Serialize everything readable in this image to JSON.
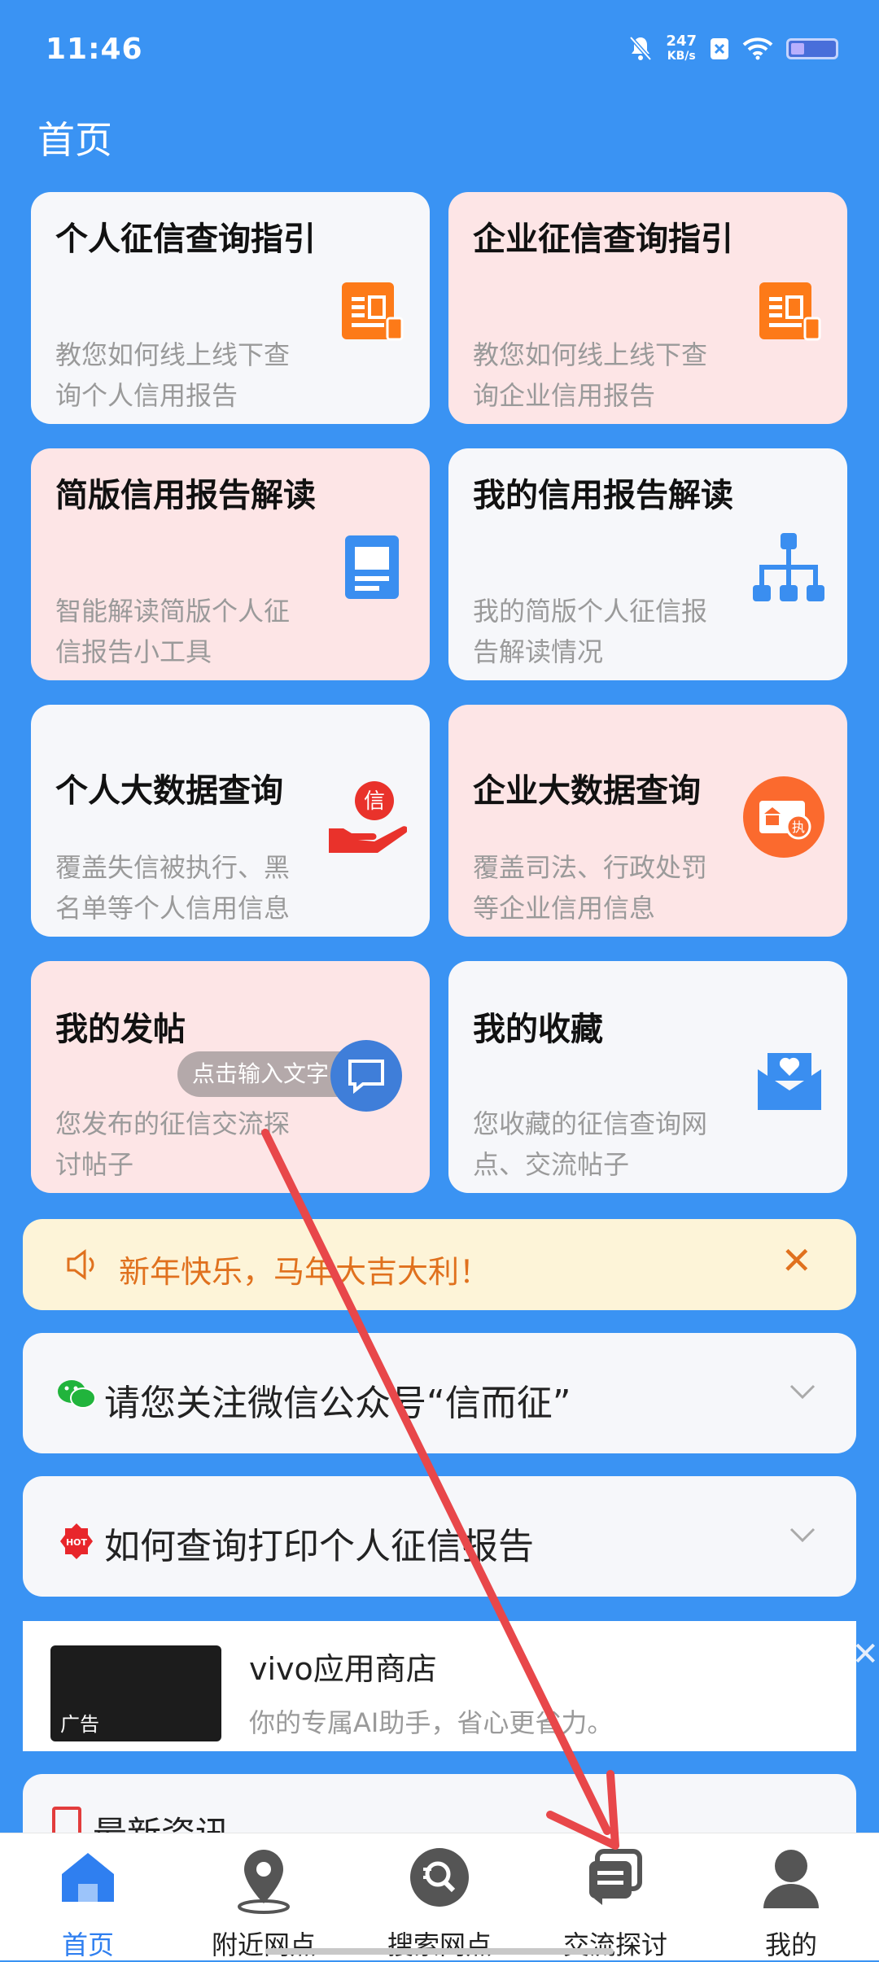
{
  "status": {
    "time": "11:46",
    "speed_value": "247",
    "speed_unit": "KB/s"
  },
  "page_title": "首页",
  "cards": [
    {
      "title": "个人征信查询指引",
      "desc": "教您如何线上线下查询个人信用报告",
      "icon": "document-icon",
      "bg": "white"
    },
    {
      "title": "企业征信查询指引",
      "desc": "教您如何线上线下查询企业信用报告",
      "icon": "document-icon",
      "bg": "pink"
    },
    {
      "title": "简版信用报告解读",
      "desc": "智能解读简版个人征信报告小工具",
      "icon": "report-icon",
      "bg": "pink"
    },
    {
      "title": "我的信用报告解读",
      "desc": "我的简版个人征信报告解读情况",
      "icon": "hierarchy-icon",
      "bg": "white"
    },
    {
      "title": "个人大数据查询",
      "desc": "覆盖失信被执行、黑名单等个人信用信息",
      "icon": "credit-hand-icon",
      "bg": "white"
    },
    {
      "title": "企业大数据查询",
      "desc": "覆盖司法、行政处罚等企业信用信息",
      "icon": "enterprise-license-icon",
      "bg": "pink"
    },
    {
      "title": "我的发帖",
      "desc": "您发布的征信交流探讨帖子",
      "icon": "chat-icon",
      "bg": "pink"
    },
    {
      "title": "我的收藏",
      "desc": "您收藏的征信查询网点、交流帖子",
      "icon": "favorite-icon",
      "bg": "white"
    }
  ],
  "overlay_hint": "点击输入文字",
  "notice": {
    "text": "新年快乐，马年大吉大利！"
  },
  "accordions": [
    {
      "text": "请您关注微信公众号“信而征”",
      "icon": "wechat-icon"
    },
    {
      "text": "如何查询打印个人征信报告",
      "icon": "hot-icon"
    }
  ],
  "ad": {
    "name": "vivo应用商店",
    "desc": "你的专属AI助手，省心更省力。",
    "label": "广告"
  },
  "news": {
    "title": "最新资讯"
  },
  "tabs": [
    {
      "label": "首页",
      "icon": "home-icon",
      "active": true
    },
    {
      "label": "附近网点",
      "icon": "location-pin-icon",
      "active": false
    },
    {
      "label": "搜索网点",
      "icon": "search-icon",
      "active": false
    },
    {
      "label": "交流探讨",
      "icon": "discussion-icon",
      "active": false
    },
    {
      "label": "我的",
      "icon": "user-icon",
      "active": false
    }
  ],
  "colors": {
    "primary": "#3a93f3",
    "accent_orange": "#fd7a18",
    "pink_card": "#fde5e6"
  }
}
